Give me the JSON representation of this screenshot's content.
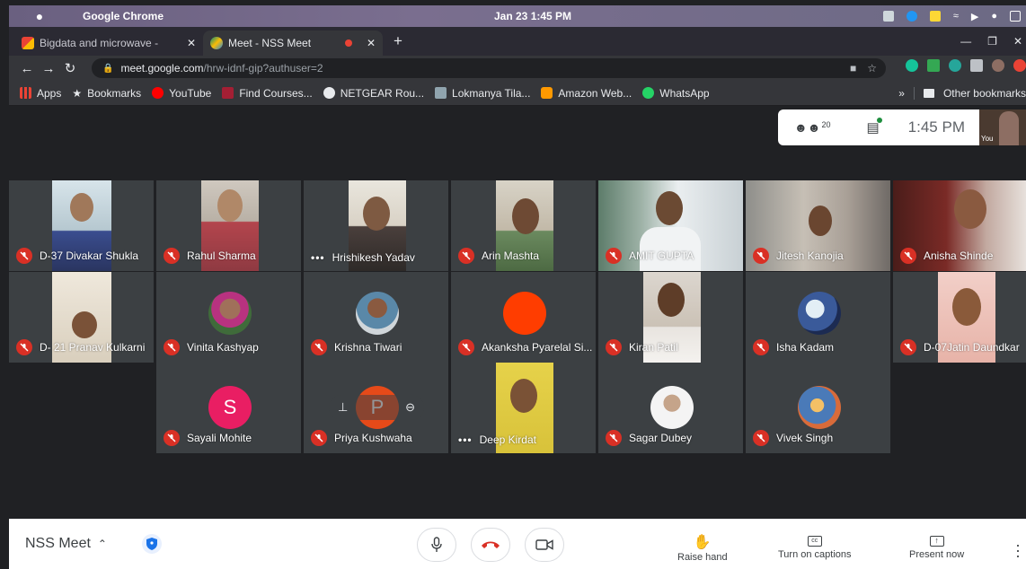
{
  "menubar": {
    "app_name": "Google Chrome",
    "datetime": "Jan 23  1:45 PM"
  },
  "tabs": [
    {
      "label": "Bigdata and microwave -",
      "active": false
    },
    {
      "label": "Meet - NSS Meet",
      "active": true
    }
  ],
  "omnibox": {
    "host": "meet.google.com",
    "path": "/hrw-idnf-gip?authuser=2"
  },
  "bookmarks": {
    "items": [
      "Apps",
      "Bookmarks",
      "YouTube",
      "Find Courses...",
      "NETGEAR Rou...",
      "Lokmanya Tila...",
      "Amazon Web...",
      "WhatsApp"
    ],
    "more_label": "»",
    "other_label": "Other bookmarks"
  },
  "meet_info": {
    "participant_count": "20",
    "time": "1:45 PM",
    "self_label": "You"
  },
  "participants": [
    {
      "name": "D-37 Divakar Shukla",
      "status": "muted"
    },
    {
      "name": "Rahul Sharma",
      "status": "muted"
    },
    {
      "name": "Hrishikesh Yadav",
      "status": "speaking"
    },
    {
      "name": "Arin Mashta",
      "status": "muted"
    },
    {
      "name": "AMIT GUPTA",
      "status": "muted"
    },
    {
      "name": "Jitesh Kanojia",
      "status": "muted"
    },
    {
      "name": "Anisha Shinde",
      "status": "muted"
    },
    {
      "name": "D- 21 Pranav Kulkarni",
      "status": "muted"
    },
    {
      "name": "Vinita Kashyap",
      "status": "muted"
    },
    {
      "name": "Krishna Tiwari",
      "status": "muted"
    },
    {
      "name": "Akanksha Pyarelal Si...",
      "status": "muted"
    },
    {
      "name": "Kiran Patil",
      "status": "muted"
    },
    {
      "name": "Isha Kadam",
      "status": "muted"
    },
    {
      "name": "D-07Jatin Daundkar",
      "status": "muted"
    },
    {
      "name": "Sayali Mohite",
      "status": "muted",
      "initial": "S"
    },
    {
      "name": "Priya Kushwaha",
      "status": "muted",
      "initial": "P"
    },
    {
      "name": "Deep Kirdat",
      "status": "speaking"
    },
    {
      "name": "Sagar Dubey",
      "status": "muted"
    },
    {
      "name": "Vivek Singh",
      "status": "muted"
    }
  ],
  "bottom": {
    "meeting_name": "NSS Meet",
    "raise_hand": "Raise hand",
    "captions": "Turn on captions",
    "present": "Present now"
  },
  "colors": {
    "muted_red": "#d93025",
    "sayali_avatar": "#e91e63",
    "priya_avatar": "#e64a19",
    "akanksha_avatar": "#ff3d00",
    "tile_bg": "#3c4043"
  }
}
